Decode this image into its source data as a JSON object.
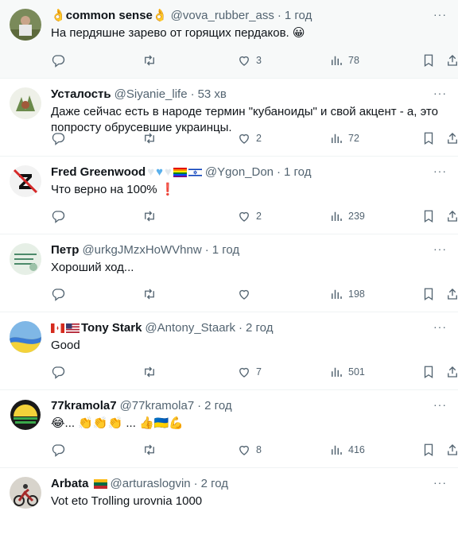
{
  "tweets": [
    {
      "name": "common sense",
      "handle": "@vova_rubber_ass",
      "sep": "·",
      "time": "1 год",
      "text": "На пердяшне зарево от горящих пердаков. 😀",
      "replies": "",
      "retweets": "",
      "likes": "3",
      "views": "78"
    },
    {
      "name": "Усталость",
      "handle": "@Siyanie_life",
      "sep": "·",
      "time": "53 хв",
      "text": "Даже сейчас есть в народе термин \"кубаноиды\" и свой акцент -  а, это попросту обрусевшие украинцы.",
      "replies": "",
      "retweets": "",
      "likes": "2",
      "views": "72"
    },
    {
      "name": "Fred Greenwood",
      "handle": "@Ygon_Don",
      "sep": "·",
      "time": "1 год",
      "text": "Что верно на 100%",
      "replies": "",
      "retweets": "",
      "likes": "2",
      "views": "239"
    },
    {
      "name": "Петр",
      "handle": "@urkgJMzxHoWVhnw",
      "sep": "·",
      "time": "1 год",
      "text": "Хороший ход...",
      "replies": "",
      "retweets": "",
      "likes": "",
      "views": "198"
    },
    {
      "name": "Tony Stark",
      "handle": "@Antony_Staark",
      "sep": "·",
      "time": "2 год",
      "text": "Good",
      "replies": "",
      "retweets": "",
      "likes": "7",
      "views": "501"
    },
    {
      "name": "77kramola7",
      "handle": "@77kramola7",
      "sep": "·",
      "time": "2 год",
      "text": "😂... 👏👏👏 ... 👍🇺🇦💪",
      "replies": "",
      "retweets": "",
      "likes": "8",
      "views": "416"
    },
    {
      "name": "Arbata",
      "handle": "@arturaslogvin",
      "sep": "·",
      "time": "2 год",
      "text": "Vot eto Trolling urovnia 1000",
      "replies": "",
      "retweets": "",
      "likes": "",
      "views": ""
    }
  ],
  "icons": {
    "reply": "reply-icon",
    "retweet": "retweet-icon",
    "like": "like-icon",
    "views": "views-icon",
    "bookmark": "bookmark-icon",
    "share": "share-icon",
    "more": "more-icon"
  },
  "colors": {
    "accent": "#1d9bf0",
    "muted": "#536471"
  }
}
